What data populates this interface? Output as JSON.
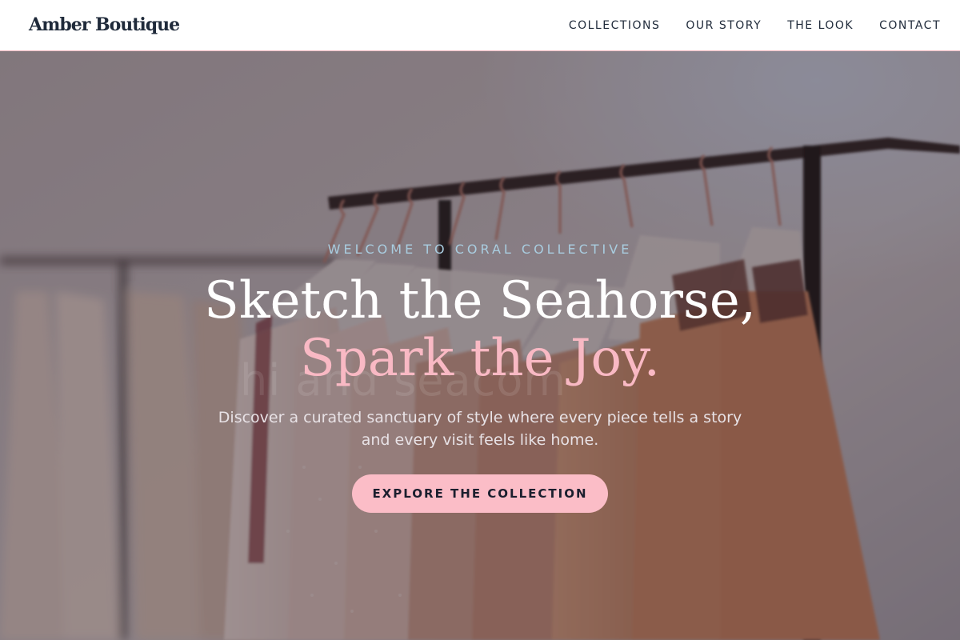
{
  "header": {
    "brand": "Amber Boutique",
    "nav": [
      {
        "label": "COLLECTIONS"
      },
      {
        "label": "OUR STORY"
      },
      {
        "label": "THE LOOK"
      },
      {
        "label": "CONTACT"
      }
    ]
  },
  "hero": {
    "eyebrow": "WELCOME TO CORAL COLLECTIVE",
    "headline_line1": "Sketch the Seahorse,",
    "headline_line2": "Spark the Joy.",
    "subtitle": "Discover a curated sanctuary of style where every piece tells a story and every visit feels like home.",
    "cta_label": "EXPLORE THE COLLECTION",
    "watermark": "hi   and seacom"
  },
  "colors": {
    "accent_pink": "#fbbdc7",
    "headline_pink": "#f9b9c4",
    "eyebrow_blue": "#a9cde0",
    "text_dark": "#1f2a3a"
  }
}
